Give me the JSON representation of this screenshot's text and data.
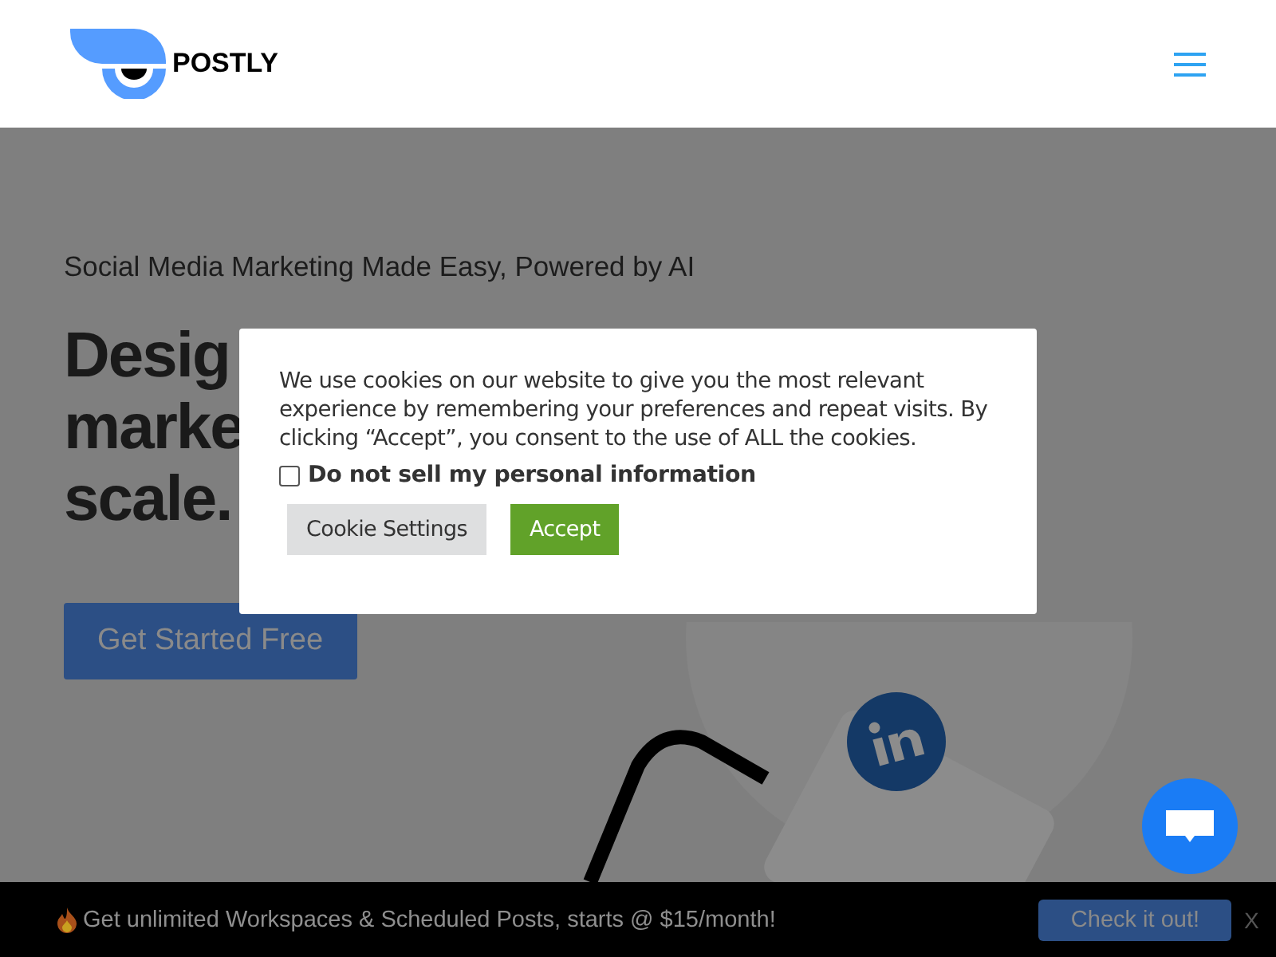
{
  "header": {
    "logo_text": "POSTLY"
  },
  "hero": {
    "tagline": "Social Media Marketing Made Easy, Powered by AI",
    "headline_lines": [
      "Desig",
      "marke",
      "scale."
    ],
    "cta": "Get Started Free"
  },
  "cookie_notice": {
    "message": "We use cookies on our website to give you the most relevant experience by remembering your preferences and repeat visits. By clicking “Accept”, you consent to the use of ALL the cookies.",
    "opt_out": {
      "label": "Do not sell my personal information",
      "checked": false
    },
    "buttons": [
      {
        "label": "Cookie Settings",
        "kind": "secondary"
      },
      {
        "label": "Accept",
        "kind": "primary"
      }
    ]
  },
  "promo_bar": {
    "message": "Get unlimited Workspaces & Scheduled Posts, starts @ $15/month!",
    "button": "Check it out!",
    "close": "X"
  }
}
